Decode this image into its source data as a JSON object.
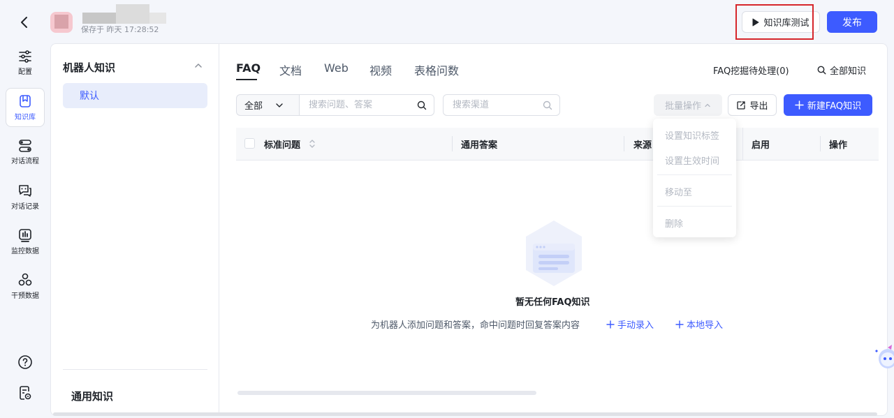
{
  "header": {
    "save_time": "保存于 昨天 17:28:52",
    "test_label": "知识库测试",
    "publish_label": "发布"
  },
  "nav": {
    "items": [
      {
        "label": "配置",
        "icon": "sliders-icon"
      },
      {
        "label": "知识库",
        "icon": "bookmark-icon",
        "active": true
      },
      {
        "label": "对话流程",
        "icon": "flow-icon"
      },
      {
        "label": "对话记录",
        "icon": "chat-icon"
      },
      {
        "label": "监控数据",
        "icon": "chart-icon"
      },
      {
        "label": "干预数据",
        "icon": "circles-icon"
      }
    ],
    "bottom": [
      "help-icon",
      "document-settings-icon"
    ]
  },
  "kb": {
    "title": "机器人知识",
    "default_item": "默认",
    "general": "通用知识"
  },
  "tabs": [
    "FAQ",
    "文档",
    "Web",
    "视频",
    "表格问数"
  ],
  "toolbar": {
    "faq_mining": "FAQ挖掘待处理(0)",
    "all_knowledge": "全部知识",
    "filter_value": "全部",
    "search_placeholder": "搜索问题、答案",
    "channel_placeholder": "搜索渠道",
    "batch_label": "批量操作",
    "export_label": "导出",
    "new_label": "新建FAQ知识"
  },
  "table": {
    "columns": [
      "标准问题",
      "通用答案",
      "来源",
      "启用",
      "操作"
    ]
  },
  "batch_menu": {
    "items": [
      "设置知识标签",
      "设置生效时间",
      "移动至",
      "删除"
    ]
  },
  "empty": {
    "title": "暂无任何FAQ知识",
    "description": "为机器人添加问题和答案，命中问题时回复答案内容",
    "manual_label": "手动录入",
    "import_label": "本地导入"
  },
  "colors": {
    "primary": "#3d5bff",
    "highlight": "#d6262b"
  }
}
